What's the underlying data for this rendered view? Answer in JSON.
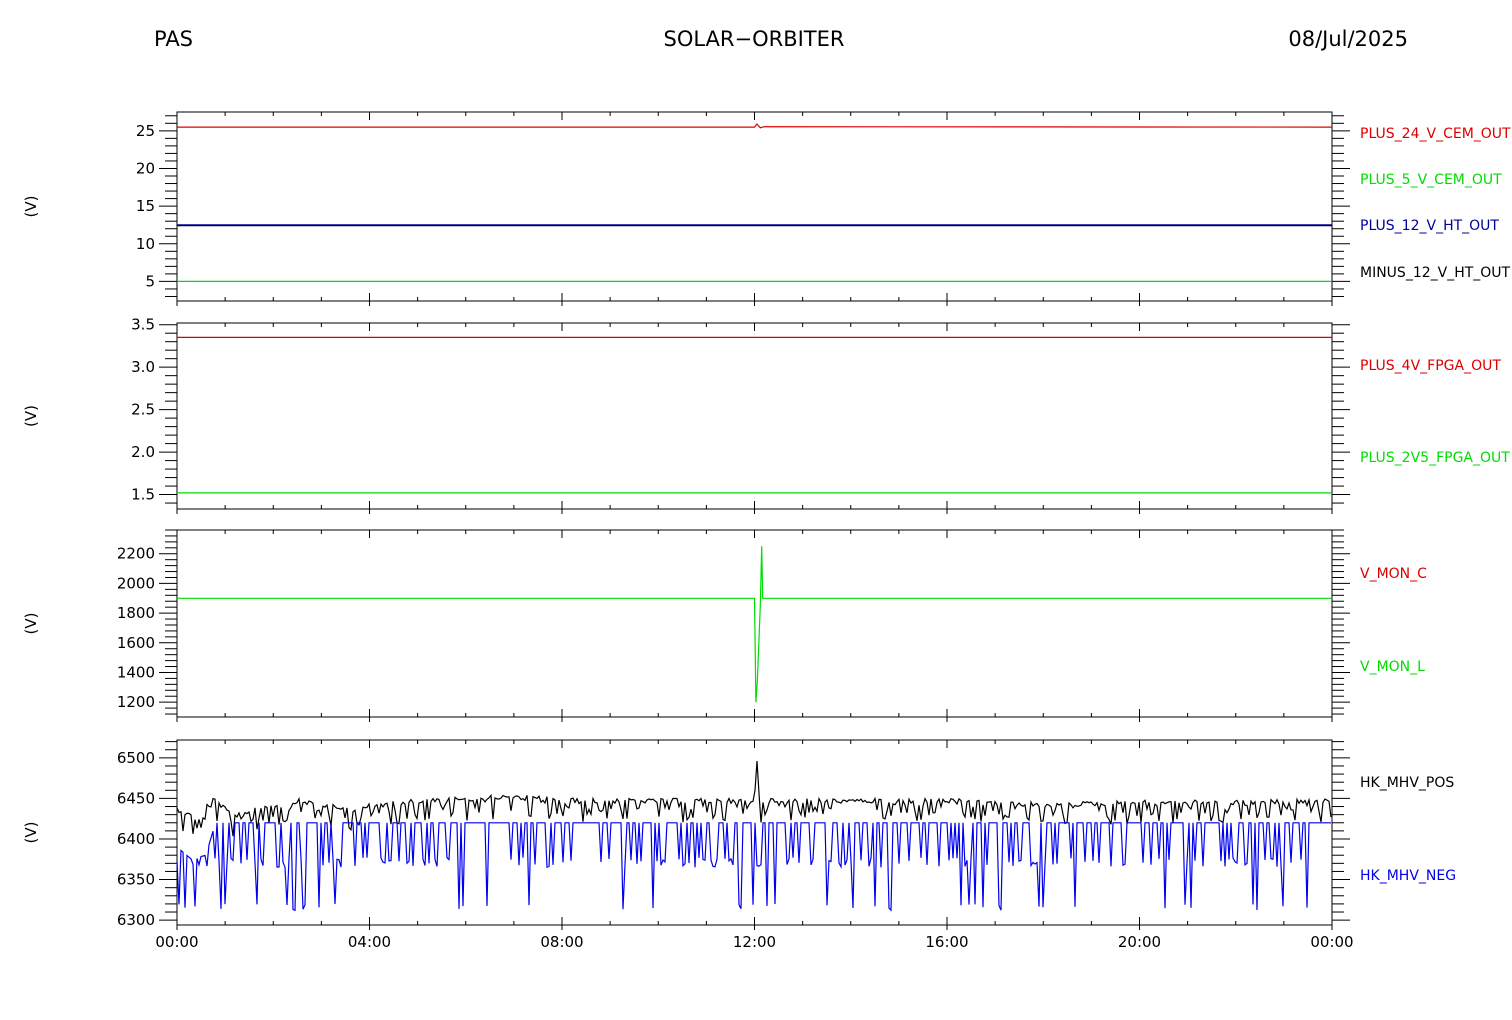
{
  "header": {
    "left": "PAS",
    "center": "SOLAR−ORBITER",
    "right": "08/Jul/2025"
  },
  "chart_data": [
    {
      "type": "line",
      "ylabel": "(V)",
      "ylim": [
        2.4,
        27.5
      ],
      "yticks": [
        5,
        10,
        15,
        20,
        25
      ],
      "xlim": [
        "00:00",
        "24:00"
      ],
      "series": [
        {
          "name": "PLUS_24_V_CEM_OUT",
          "color": "#dd0000",
          "shape": "flat",
          "points": [
            [
              0,
              25.5
            ],
            [
              12.0,
              25.5
            ],
            [
              12.05,
              25.9
            ],
            [
              12.12,
              25.4
            ],
            [
              12.2,
              25.55
            ],
            [
              24,
              25.5
            ]
          ]
        },
        {
          "name": "PLUS_5_V_CEM_OUT",
          "color": "#00dd00",
          "shape": "flat",
          "points": [
            [
              0,
              5.0
            ],
            [
              24,
              5.0
            ]
          ]
        },
        {
          "name": "PLUS_12_V_HT_OUT",
          "color": "#000099",
          "shape": "flat",
          "points": [
            [
              0,
              12.5
            ],
            [
              24,
              12.5
            ]
          ]
        },
        {
          "name": "MINUS_12_V_HT_OUT",
          "color": "#000000",
          "shape": "flat",
          "points": [
            [
              0,
              12.4
            ],
            [
              24,
              12.4
            ]
          ]
        }
      ]
    },
    {
      "type": "line",
      "ylabel": "(V)",
      "ylim": [
        1.33,
        3.52
      ],
      "yticks": [
        1.5,
        2.0,
        2.5,
        3.0,
        3.5
      ],
      "xlim": [
        "00:00",
        "24:00"
      ],
      "series": [
        {
          "name": "PLUS_4V_FPGA_OUT",
          "color": "#dd0000",
          "shape": "flat",
          "points": [
            [
              0,
              3.35
            ],
            [
              24,
              3.35
            ]
          ]
        },
        {
          "name": "PLUS_2V5_FPGA_OUT",
          "color": "#00dd00",
          "shape": "flat",
          "points": [
            [
              0,
              1.52
            ],
            [
              24,
              1.52
            ]
          ]
        }
      ]
    },
    {
      "type": "line",
      "ylabel": "(V)",
      "ylim": [
        1100,
        2360
      ],
      "yticks": [
        1200,
        1400,
        1600,
        1800,
        2000,
        2200
      ],
      "xlim": [
        "00:00",
        "24:00"
      ],
      "series": [
        {
          "name": "V_MON_C",
          "color": "#dd0000",
          "shape": "flat",
          "points": []
        },
        {
          "name": "V_MON_L",
          "color": "#00dd00",
          "shape": "flat",
          "points": [
            [
              0,
              1900
            ],
            [
              12.0,
              1900
            ],
            [
              12.03,
              1200
            ],
            [
              12.06,
              1350
            ],
            [
              12.12,
              1850
            ],
            [
              12.15,
              2250
            ],
            [
              12.17,
              1900
            ],
            [
              24,
              1900
            ]
          ]
        }
      ]
    },
    {
      "type": "line",
      "ylabel": "(V)",
      "ylim": [
        6294,
        6522
      ],
      "yticks": [
        6300,
        6350,
        6400,
        6450,
        6500
      ],
      "xlim": [
        "00:00",
        "24:00"
      ],
      "series": [
        {
          "name": "HK_MHV_POS",
          "color": "#000000",
          "shape": "noisy",
          "points": [
            [
              0,
              6440
            ],
            [
              0.5,
              6425
            ],
            [
              0.7,
              6455
            ],
            [
              1.2,
              6430
            ],
            [
              1.6,
              6440
            ],
            [
              2.5,
              6450
            ],
            [
              3.5,
              6440
            ],
            [
              5.0,
              6450
            ],
            [
              7.0,
              6455
            ],
            [
              8.5,
              6450
            ],
            [
              10.5,
              6450
            ],
            [
              12.0,
              6450
            ],
            [
              12.05,
              6498
            ],
            [
              12.1,
              6450
            ],
            [
              14.0,
              6450
            ],
            [
              16.0,
              6450
            ],
            [
              18.0,
              6445
            ],
            [
              20.0,
              6448
            ],
            [
              22.0,
              6448
            ],
            [
              24,
              6450
            ]
          ]
        },
        {
          "name": "HK_MHV_NEG",
          "color": "#0000ee",
          "shape": "dips",
          "points": [
            [
              0,
              6390
            ],
            [
              0.3,
              6375
            ],
            [
              0.6,
              6380
            ],
            [
              0.8,
              6420
            ],
            [
              24,
              6420
            ]
          ]
        }
      ]
    }
  ],
  "xaxis": {
    "ticklabels": [
      "00:00",
      "04:00",
      "08:00",
      "12:00",
      "16:00",
      "20:00",
      "00:00"
    ]
  }
}
